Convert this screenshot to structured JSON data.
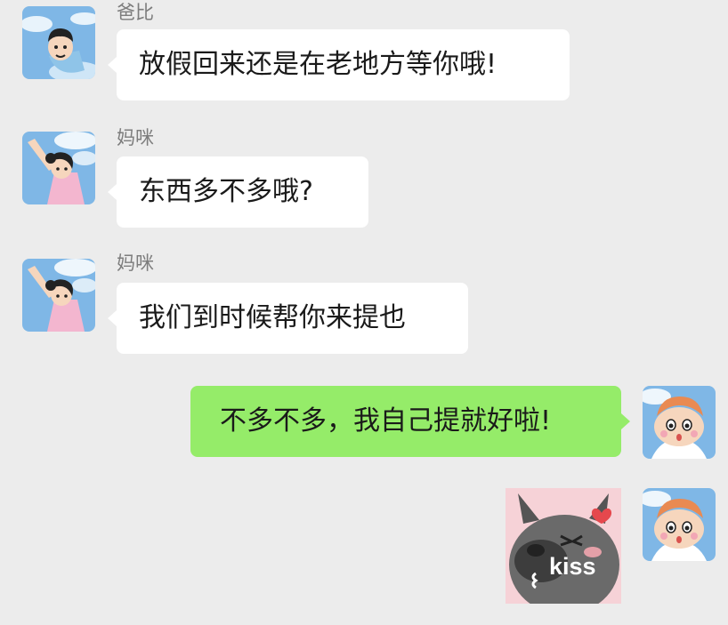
{
  "chat": {
    "messages": [
      {
        "sender": "爸比",
        "text": "放假回来还是在老地方等你哦!"
      },
      {
        "sender": "妈咪",
        "text": "东西多不多哦?"
      },
      {
        "sender": "妈咪",
        "text": "我们到时候帮你来提也"
      },
      {
        "sender": "",
        "text": "不多不多，我自己提就好啦!"
      },
      {
        "sender": "",
        "sticker": "kiss-sticker",
        "sticker_text": "kiss"
      }
    ]
  },
  "colors": {
    "background": "#ececec",
    "incoming_bubble": "#ffffff",
    "outgoing_bubble": "#95ec69",
    "sender_name": "#7d7d7d"
  },
  "icons": {
    "dad_avatar": "cartoon-dad-avatar",
    "mom_avatar": "cartoon-mom-avatar",
    "self_avatar": "cartoon-kid-avatar",
    "sticker": "gray-cat-kiss-sticker"
  }
}
